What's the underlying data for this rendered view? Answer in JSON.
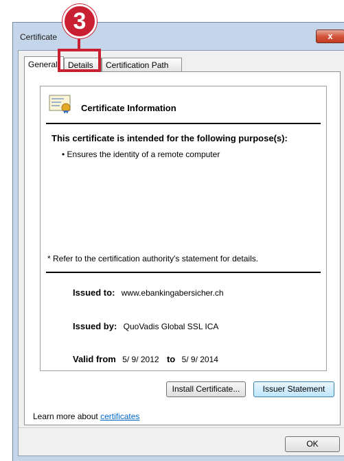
{
  "window": {
    "title": "Certificate",
    "close_symbol": "x"
  },
  "tabs": [
    {
      "label": "General",
      "active": true
    },
    {
      "label": "Details",
      "active": false
    },
    {
      "label": "Certification Path",
      "active": false
    }
  ],
  "info": {
    "heading": "Certificate Information",
    "purpose_heading": "This certificate is intended for the following purpose(s):",
    "purposes": [
      "• Ensures the identity of a remote computer"
    ],
    "footnote": "* Refer to the certification authority's statement for details.",
    "issued_to_label": "Issued to:",
    "issued_to_value": "www.ebankingabersicher.ch",
    "issued_by_label": "Issued by:",
    "issued_by_value": "QuoVadis Global SSL ICA",
    "valid_from_label": "Valid from",
    "valid_from_value": "5/ 9/ 2012",
    "valid_to_label": "to",
    "valid_to_value": "5/ 9/ 2014"
  },
  "buttons": {
    "install": "Install Certificate...",
    "issuer_statement": "Issuer Statement",
    "ok": "OK"
  },
  "learn_more": {
    "prefix": "Learn more about ",
    "link": "certificates"
  },
  "annotation": {
    "step_number": "3",
    "color": "#c82032"
  }
}
